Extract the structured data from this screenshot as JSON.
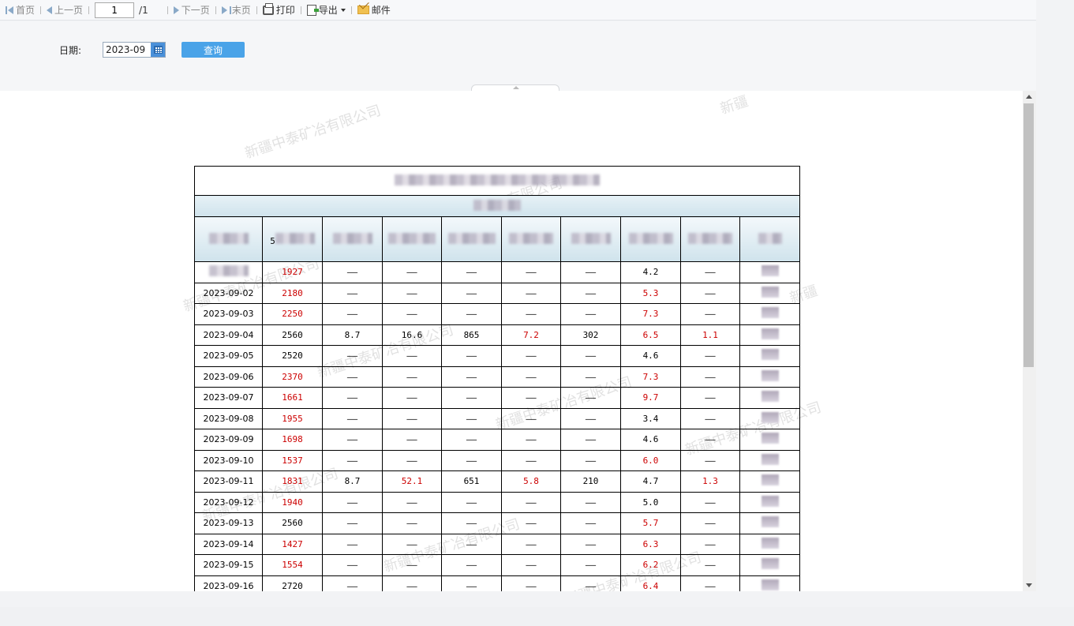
{
  "toolbar": {
    "first": "首页",
    "prev": "上一页",
    "page_value": "1",
    "page_total": "/1",
    "next": "下一页",
    "last": "末页",
    "print": "打印",
    "export": "导出",
    "mail": "邮件"
  },
  "query": {
    "date_label": "日期:",
    "date_value": "2023-09",
    "query_button": "查询"
  },
  "watermark_text": "新疆中泰矿冶有限公司",
  "watermark_partial": "新疆",
  "table": {
    "header_partial": "5",
    "rows": [
      {
        "date": "",
        "c1": "1927",
        "c1_red": true,
        "c2": "——",
        "c3": "——",
        "c4": "——",
        "c5": "——",
        "c5_red": false,
        "c6": "——",
        "c7": "4.2",
        "c7_red": false,
        "c8": "——",
        "c8_red": false
      },
      {
        "date": "2023-09-02",
        "c1": "2180",
        "c1_red": true,
        "c2": "——",
        "c3": "——",
        "c4": "——",
        "c5": "——",
        "c5_red": false,
        "c6": "——",
        "c7": "5.3",
        "c7_red": true,
        "c8": "——",
        "c8_red": false
      },
      {
        "date": "2023-09-03",
        "c1": "2250",
        "c1_red": true,
        "c2": "——",
        "c3": "——",
        "c4": "——",
        "c5": "——",
        "c5_red": false,
        "c6": "——",
        "c7": "7.3",
        "c7_red": true,
        "c8": "——",
        "c8_red": false
      },
      {
        "date": "2023-09-04",
        "c1": "2560",
        "c1_red": false,
        "c2": "8.7",
        "c3": "16.6",
        "c4": "865",
        "c5": "7.2",
        "c5_red": true,
        "c6": "302",
        "c7": "6.5",
        "c7_red": true,
        "c8": "1.1",
        "c8_red": true
      },
      {
        "date": "2023-09-05",
        "c1": "2520",
        "c1_red": false,
        "c2": "——",
        "c3": "——",
        "c4": "——",
        "c5": "——",
        "c5_red": false,
        "c6": "——",
        "c7": "4.6",
        "c7_red": false,
        "c8": "——",
        "c8_red": false
      },
      {
        "date": "2023-09-06",
        "c1": "2370",
        "c1_red": true,
        "c2": "——",
        "c3": "——",
        "c4": "——",
        "c5": "——",
        "c5_red": false,
        "c6": "——",
        "c7": "7.3",
        "c7_red": true,
        "c8": "——",
        "c8_red": false
      },
      {
        "date": "2023-09-07",
        "c1": "1661",
        "c1_red": true,
        "c2": "——",
        "c3": "——",
        "c4": "——",
        "c5": "——",
        "c5_red": false,
        "c6": "——",
        "c7": "9.7",
        "c7_red": true,
        "c8": "——",
        "c8_red": false
      },
      {
        "date": "2023-09-08",
        "c1": "1955",
        "c1_red": true,
        "c2": "——",
        "c3": "——",
        "c4": "——",
        "c5": "——",
        "c5_red": false,
        "c6": "——",
        "c7": "3.4",
        "c7_red": false,
        "c8": "——",
        "c8_red": false
      },
      {
        "date": "2023-09-09",
        "c1": "1698",
        "c1_red": true,
        "c2": "——",
        "c3": "——",
        "c4": "——",
        "c5": "——",
        "c5_red": false,
        "c6": "——",
        "c7": "4.6",
        "c7_red": false,
        "c8": "——",
        "c8_red": false
      },
      {
        "date": "2023-09-10",
        "c1": "1537",
        "c1_red": true,
        "c2": "——",
        "c3": "——",
        "c4": "——",
        "c5": "——",
        "c5_red": false,
        "c6": "——",
        "c7": "6.0",
        "c7_red": true,
        "c8": "——",
        "c8_red": false
      },
      {
        "date": "2023-09-11",
        "c1": "1831",
        "c1_red": true,
        "c2": "8.7",
        "c3": "52.1",
        "c3_red": true,
        "c4": "651",
        "c5": "5.8",
        "c5_red": true,
        "c6": "210",
        "c7": "4.7",
        "c7_red": false,
        "c8": "1.3",
        "c8_red": true
      },
      {
        "date": "2023-09-12",
        "c1": "1940",
        "c1_red": true,
        "c2": "——",
        "c3": "——",
        "c4": "——",
        "c5": "——",
        "c5_red": false,
        "c6": "——",
        "c7": "5.0",
        "c7_red": false,
        "c8": "——",
        "c8_red": false
      },
      {
        "date": "2023-09-13",
        "c1": "2560",
        "c1_red": false,
        "c2": "——",
        "c3": "——",
        "c4": "——",
        "c5": "——",
        "c5_red": false,
        "c6": "——",
        "c7": "5.7",
        "c7_red": true,
        "c8": "——",
        "c8_red": false
      },
      {
        "date": "2023-09-14",
        "c1": "1427",
        "c1_red": true,
        "c2": "——",
        "c3": "——",
        "c4": "——",
        "c5": "——",
        "c5_red": false,
        "c6": "——",
        "c7": "6.3",
        "c7_red": true,
        "c8": "——",
        "c8_red": false
      },
      {
        "date": "2023-09-15",
        "c1": "1554",
        "c1_red": true,
        "c2": "——",
        "c3": "——",
        "c4": "——",
        "c5": "——",
        "c5_red": false,
        "c6": "——",
        "c7": "6.2",
        "c7_red": true,
        "c8": "——",
        "c8_red": false
      },
      {
        "date": "2023-09-16",
        "c1": "2720",
        "c1_red": false,
        "c2": "——",
        "c3": "——",
        "c4": "——",
        "c5": "——",
        "c5_red": false,
        "c6": "——",
        "c7": "6.4",
        "c7_red": true,
        "c8": "——",
        "c8_red": false
      }
    ]
  },
  "colors": {
    "red_value": "#cc0000",
    "query_button": "#4aa3e8"
  }
}
